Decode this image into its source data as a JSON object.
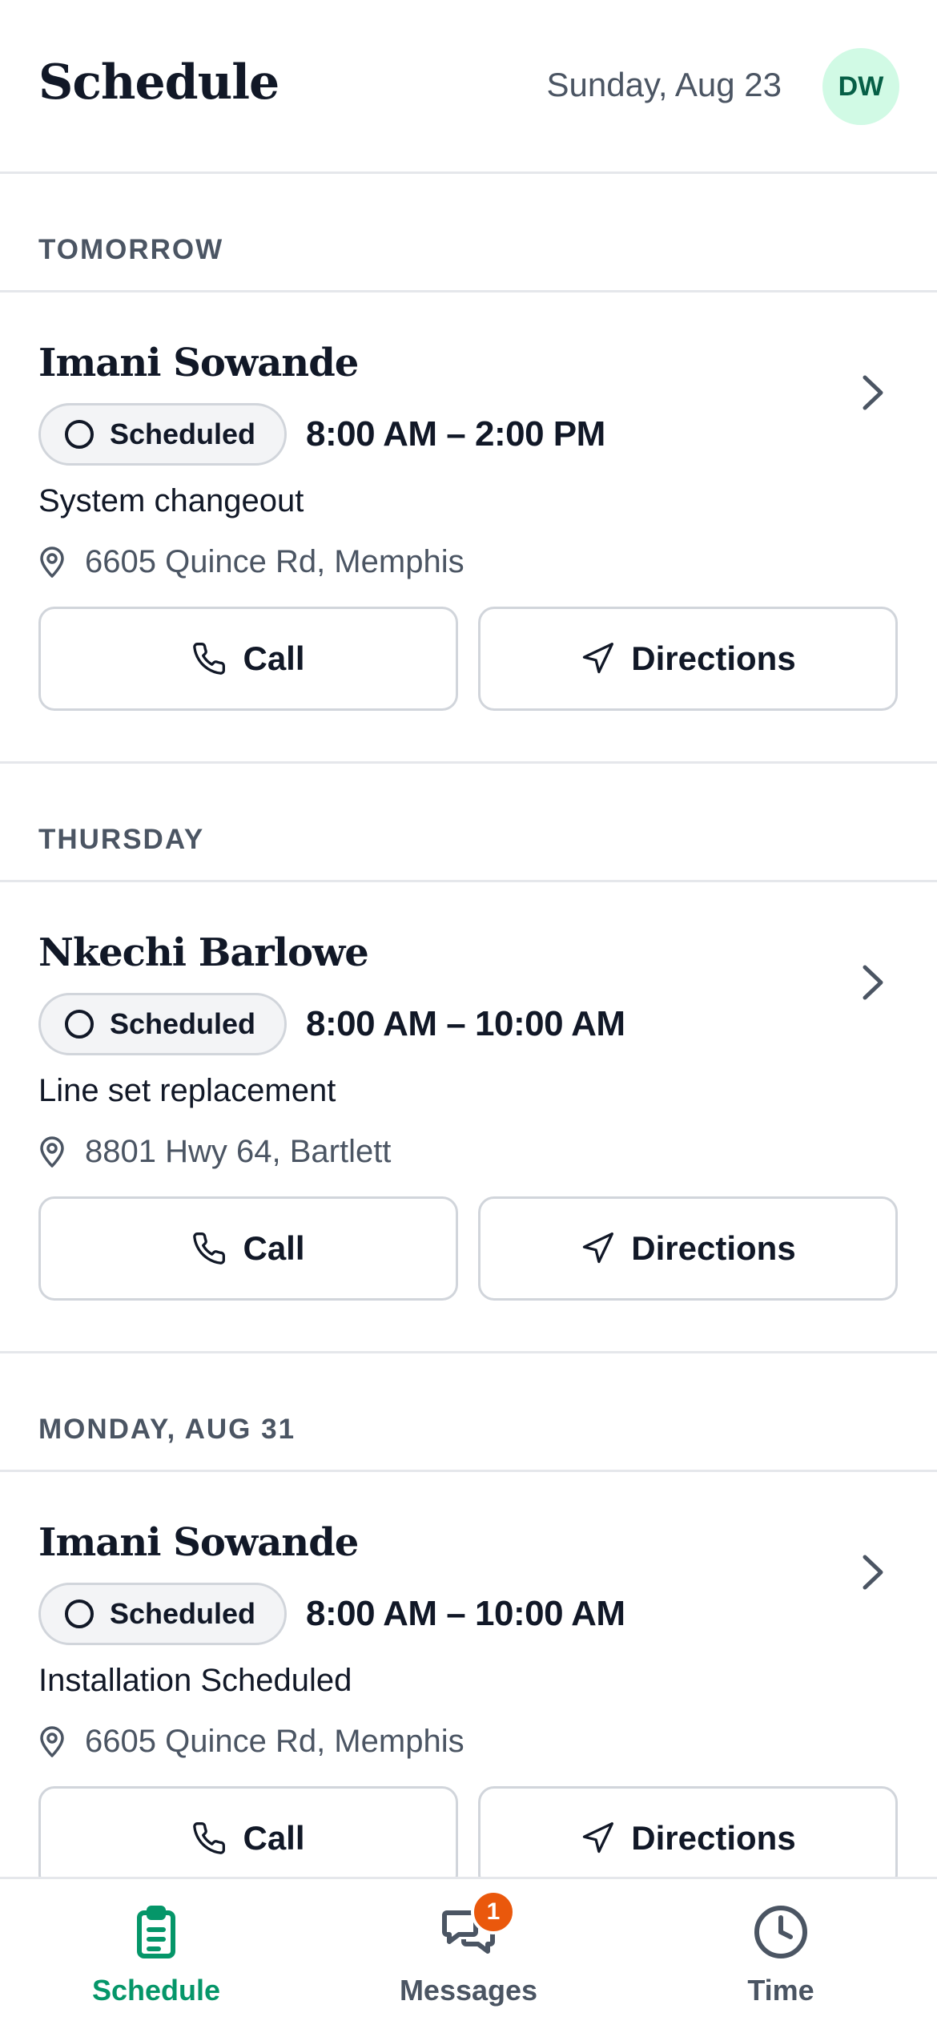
{
  "header": {
    "title": "Schedule",
    "date": "Sunday, Aug 23",
    "avatar_initials": "DW"
  },
  "sections": [
    {
      "heading": "TOMORROW",
      "job": {
        "customer": "Imani Sowande",
        "status": "Scheduled",
        "time": "8:00 AM – 2:00 PM",
        "description": "System changeout",
        "address": "6605 Quince Rd, Memphis",
        "call_label": "Call",
        "directions_label": "Directions"
      }
    },
    {
      "heading": "THURSDAY",
      "job": {
        "customer": "Nkechi Barlowe",
        "status": "Scheduled",
        "time": "8:00 AM – 10:00 AM",
        "description": "Line set replacement",
        "address": "8801 Hwy 64, Bartlett",
        "call_label": "Call",
        "directions_label": "Directions"
      }
    },
    {
      "heading": "MONDAY, AUG 31",
      "job": {
        "customer": "Imani Sowande",
        "status": "Scheduled",
        "time": "8:00 AM – 10:00 AM",
        "description": "Installation Scheduled",
        "address": "6605 Quince Rd, Memphis",
        "call_label": "Call",
        "directions_label": "Directions"
      }
    }
  ],
  "tabbar": {
    "schedule_label": "Schedule",
    "messages_label": "Messages",
    "messages_badge": "1",
    "time_label": "Time"
  },
  "colors": {
    "accent": "#059669",
    "badge": "#ea580c",
    "avatar_bg": "#d1fae5"
  }
}
